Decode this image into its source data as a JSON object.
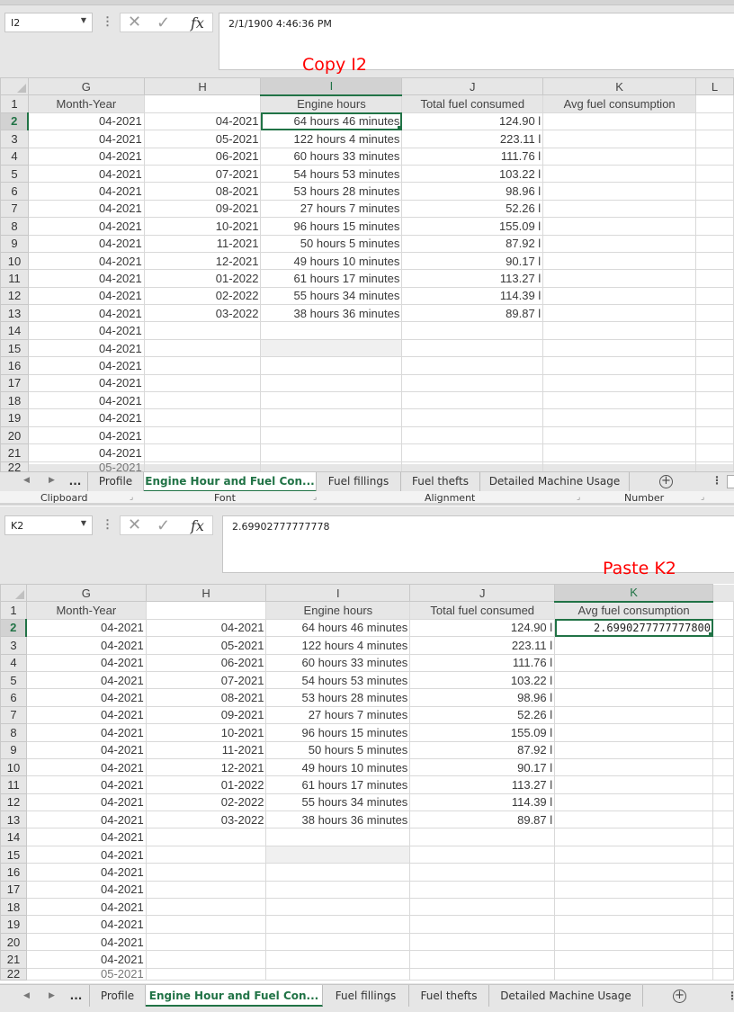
{
  "top": {
    "annotation": "Copy I2",
    "name_box": "I2",
    "formula_bar_value": "2/1/1900  4:46:36 PM",
    "active_column": "I",
    "active_row": "2",
    "column_headers": [
      "G",
      "H",
      "I",
      "J",
      "K",
      "L"
    ],
    "header_row": {
      "G": "Month-Year",
      "H": "",
      "I": "Engine hours",
      "J": "Total fuel consumed",
      "K": "Avg fuel consumption"
    },
    "rows": [
      {
        "n": "2",
        "G": "04-2021",
        "H": "04-2021",
        "I": "64 hours 46 minutes",
        "J": "124.90 l",
        "K": ""
      },
      {
        "n": "3",
        "G": "04-2021",
        "H": "05-2021",
        "I": "122 hours 4 minutes",
        "J": "223.11 l",
        "K": ""
      },
      {
        "n": "4",
        "G": "04-2021",
        "H": "06-2021",
        "I": "60 hours 33 minutes",
        "J": "111.76 l",
        "K": ""
      },
      {
        "n": "5",
        "G": "04-2021",
        "H": "07-2021",
        "I": "54 hours 53 minutes",
        "J": "103.22 l",
        "K": ""
      },
      {
        "n": "6",
        "G": "04-2021",
        "H": "08-2021",
        "I": "53 hours 28 minutes",
        "J": "98.96 l",
        "K": ""
      },
      {
        "n": "7",
        "G": "04-2021",
        "H": "09-2021",
        "I": "27 hours 7 minutes",
        "J": "52.26 l",
        "K": ""
      },
      {
        "n": "8",
        "G": "04-2021",
        "H": "10-2021",
        "I": "96 hours 15 minutes",
        "J": "155.09 l",
        "K": ""
      },
      {
        "n": "9",
        "G": "04-2021",
        "H": "11-2021",
        "I": "50 hours 5 minutes",
        "J": "87.92 l",
        "K": ""
      },
      {
        "n": "10",
        "G": "04-2021",
        "H": "12-2021",
        "I": "49 hours 10 minutes",
        "J": "90.17 l",
        "K": ""
      },
      {
        "n": "11",
        "G": "04-2021",
        "H": "01-2022",
        "I": "61 hours 17 minutes",
        "J": "113.27 l",
        "K": ""
      },
      {
        "n": "12",
        "G": "04-2021",
        "H": "02-2022",
        "I": "55 hours 34 minutes",
        "J": "114.39 l",
        "K": ""
      },
      {
        "n": "13",
        "G": "04-2021",
        "H": "03-2022",
        "I": "38 hours 36 minutes",
        "J": "89.87 l",
        "K": ""
      },
      {
        "n": "14",
        "G": "04-2021",
        "H": "",
        "I": "",
        "J": "",
        "K": ""
      },
      {
        "n": "15",
        "G": "04-2021",
        "H": "",
        "I": "",
        "J": "",
        "K": ""
      },
      {
        "n": "16",
        "G": "04-2021",
        "H": "",
        "I": "",
        "J": "",
        "K": ""
      },
      {
        "n": "17",
        "G": "04-2021",
        "H": "",
        "I": "",
        "J": "",
        "K": ""
      },
      {
        "n": "18",
        "G": "04-2021",
        "H": "",
        "I": "",
        "J": "",
        "K": ""
      },
      {
        "n": "19",
        "G": "04-2021",
        "H": "",
        "I": "",
        "J": "",
        "K": ""
      },
      {
        "n": "20",
        "G": "04-2021",
        "H": "",
        "I": "",
        "J": "",
        "K": ""
      },
      {
        "n": "21",
        "G": "04-2021",
        "H": "",
        "I": "",
        "J": "",
        "K": ""
      }
    ],
    "partial_row": {
      "n": "22",
      "G": "05-2021"
    },
    "ribbon_groups": [
      "Clipboard",
      "Font",
      "Alignment",
      "Number"
    ]
  },
  "bottom": {
    "annotation": "Paste K2",
    "name_box": "K2",
    "formula_bar_value": "2.69902777777778",
    "active_column": "K",
    "active_row": "2",
    "column_headers": [
      "G",
      "H",
      "I",
      "J",
      "K"
    ],
    "header_row": {
      "G": "Month-Year",
      "H": "",
      "I": "Engine hours",
      "J": "Total fuel consumed",
      "K": "Avg fuel consumption"
    },
    "rows": [
      {
        "n": "2",
        "G": "04-2021",
        "H": "04-2021",
        "I": "64 hours 46 minutes",
        "J": "124.90 l",
        "K": "2.6990277777777800"
      },
      {
        "n": "3",
        "G": "04-2021",
        "H": "05-2021",
        "I": "122 hours 4 minutes",
        "J": "223.11 l",
        "K": ""
      },
      {
        "n": "4",
        "G": "04-2021",
        "H": "06-2021",
        "I": "60 hours 33 minutes",
        "J": "111.76 l",
        "K": ""
      },
      {
        "n": "5",
        "G": "04-2021",
        "H": "07-2021",
        "I": "54 hours 53 minutes",
        "J": "103.22 l",
        "K": ""
      },
      {
        "n": "6",
        "G": "04-2021",
        "H": "08-2021",
        "I": "53 hours 28 minutes",
        "J": "98.96 l",
        "K": ""
      },
      {
        "n": "7",
        "G": "04-2021",
        "H": "09-2021",
        "I": "27 hours 7 minutes",
        "J": "52.26 l",
        "K": ""
      },
      {
        "n": "8",
        "G": "04-2021",
        "H": "10-2021",
        "I": "96 hours 15 minutes",
        "J": "155.09 l",
        "K": ""
      },
      {
        "n": "9",
        "G": "04-2021",
        "H": "11-2021",
        "I": "50 hours 5 minutes",
        "J": "87.92 l",
        "K": ""
      },
      {
        "n": "10",
        "G": "04-2021",
        "H": "12-2021",
        "I": "49 hours 10 minutes",
        "J": "90.17 l",
        "K": ""
      },
      {
        "n": "11",
        "G": "04-2021",
        "H": "01-2022",
        "I": "61 hours 17 minutes",
        "J": "113.27 l",
        "K": ""
      },
      {
        "n": "12",
        "G": "04-2021",
        "H": "02-2022",
        "I": "55 hours 34 minutes",
        "J": "114.39 l",
        "K": ""
      },
      {
        "n": "13",
        "G": "04-2021",
        "H": "03-2022",
        "I": "38 hours 36 minutes",
        "J": "89.87 l",
        "K": ""
      },
      {
        "n": "14",
        "G": "04-2021",
        "H": "",
        "I": "",
        "J": "",
        "K": ""
      },
      {
        "n": "15",
        "G": "04-2021",
        "H": "",
        "I": "",
        "J": "",
        "K": ""
      },
      {
        "n": "16",
        "G": "04-2021",
        "H": "",
        "I": "",
        "J": "",
        "K": ""
      },
      {
        "n": "17",
        "G": "04-2021",
        "H": "",
        "I": "",
        "J": "",
        "K": ""
      },
      {
        "n": "18",
        "G": "04-2021",
        "H": "",
        "I": "",
        "J": "",
        "K": ""
      },
      {
        "n": "19",
        "G": "04-2021",
        "H": "",
        "I": "",
        "J": "",
        "K": ""
      },
      {
        "n": "20",
        "G": "04-2021",
        "H": "",
        "I": "",
        "J": "",
        "K": ""
      },
      {
        "n": "21",
        "G": "04-2021",
        "H": "",
        "I": "",
        "J": "",
        "K": ""
      }
    ],
    "partial_row": {
      "n": "22",
      "G": "05-2021"
    }
  },
  "sheet_tabs": {
    "more": "...",
    "tabs": [
      "Profile",
      "Engine Hour and Fuel Con...",
      "Fuel fillings",
      "Fuel thefts",
      "Detailed Machine Usage"
    ],
    "active_index": 1,
    "add_sheet": "+",
    "menu": "⋮"
  },
  "icons": {
    "cancel": "✕",
    "enter": "✓",
    "function": "fx",
    "dropdown": "▼",
    "nav_prev": "◀",
    "nav_next": "▶"
  }
}
